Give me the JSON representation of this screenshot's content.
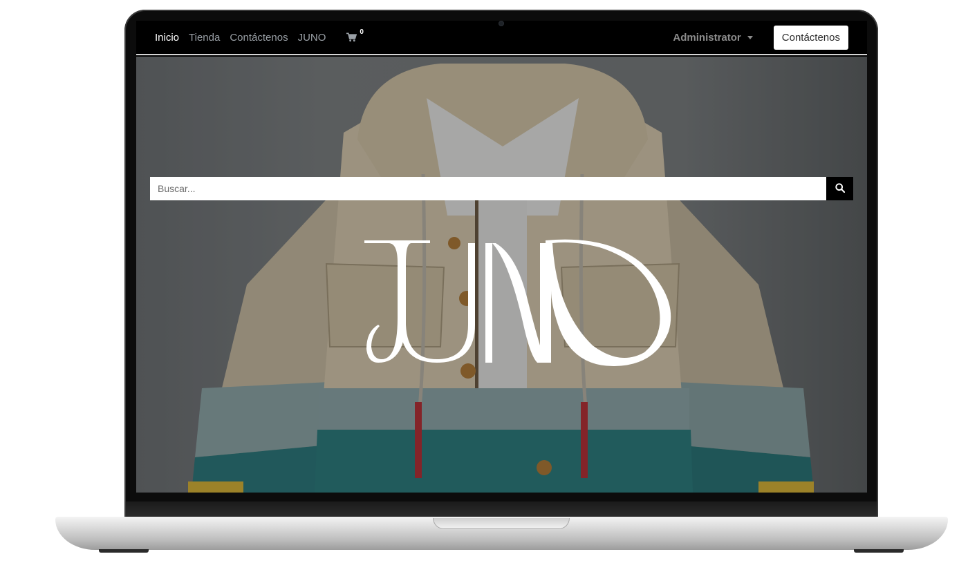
{
  "nav": {
    "links": [
      {
        "label": "Inicio",
        "active": true
      },
      {
        "label": "Tienda",
        "active": false
      },
      {
        "label": "Contáctenos",
        "active": false
      },
      {
        "label": "JUNO",
        "active": false
      }
    ],
    "cart_icon": "shopping-cart-icon",
    "cart_count": "0",
    "user_menu_label": "Administrator",
    "contact_button_label": "Contáctenos"
  },
  "hero": {
    "search_placeholder": "Buscar...",
    "search_icon": "magnifier-icon",
    "logo_text": "JUNO"
  },
  "colors": {
    "navbar_bg": "#000000",
    "accent": "#ffffff",
    "muted_link": "#9aa0a6"
  }
}
